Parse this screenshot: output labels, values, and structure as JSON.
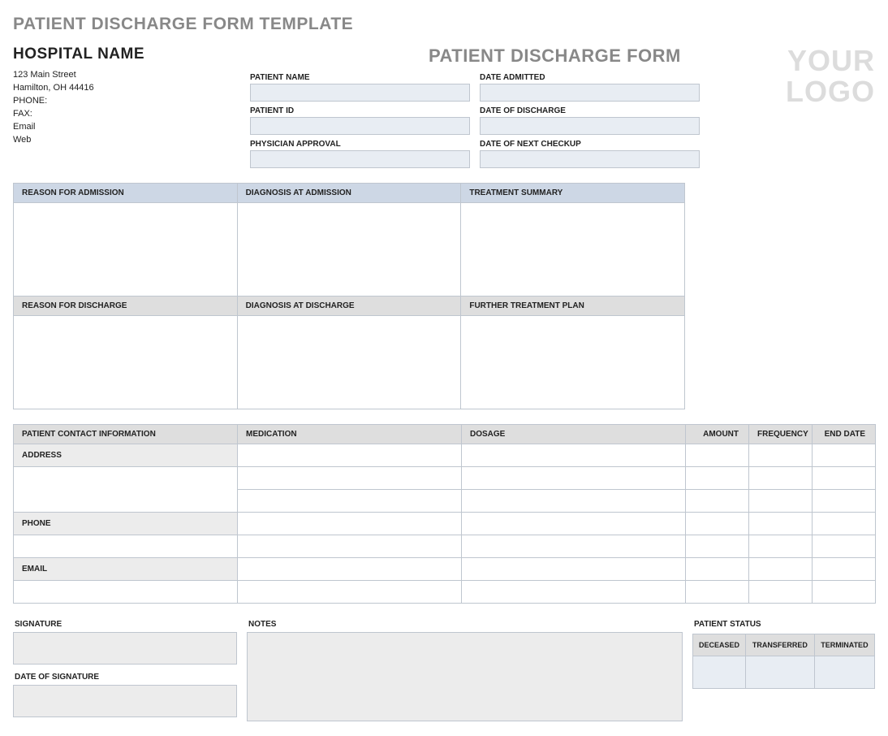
{
  "page_title": "PATIENT DISCHARGE FORM TEMPLATE",
  "hospital": {
    "name": "HOSPITAL NAME",
    "addr1": "123 Main Street",
    "addr2": "Hamilton, OH 44416",
    "phone_label": "PHONE:",
    "fax_label": "FAX:",
    "email_label": "Email",
    "web_label": "Web"
  },
  "form_title": "PATIENT DISCHARGE FORM",
  "logo_text": "YOUR LOGO",
  "fields": {
    "patient_name": "PATIENT NAME",
    "date_admitted": "DATE ADMITTED",
    "patient_id": "PATIENT ID",
    "date_discharge": "DATE OF DISCHARGE",
    "physician_approval": "PHYSICIAN APPROVAL",
    "date_next_checkup": "DATE OF NEXT CHECKUP"
  },
  "summary": {
    "reason_admission": "REASON FOR ADMISSION",
    "diagnosis_admission": "DIAGNOSIS AT ADMISSION",
    "treatment_summary": "TREATMENT SUMMARY",
    "reason_discharge": "REASON FOR DISCHARGE",
    "diagnosis_discharge": "DIAGNOSIS AT DISCHARGE",
    "further_plan": "FURTHER TREATMENT PLAN"
  },
  "med_table": {
    "contact_header": "PATIENT CONTACT INFORMATION",
    "medication": "MEDICATION",
    "dosage": "DOSAGE",
    "amount": "AMOUNT",
    "frequency": "FREQUENCY",
    "end_date": "END DATE",
    "address": "ADDRESS",
    "phone": "PHONE",
    "email": "EMAIL"
  },
  "footer": {
    "signature": "SIGNATURE",
    "date_signature": "DATE OF SIGNATURE",
    "notes": "NOTES",
    "patient_status": "PATIENT STATUS",
    "deceased": "DECEASED",
    "transferred": "TRANSFERRED",
    "terminated": "TERMINATED"
  }
}
